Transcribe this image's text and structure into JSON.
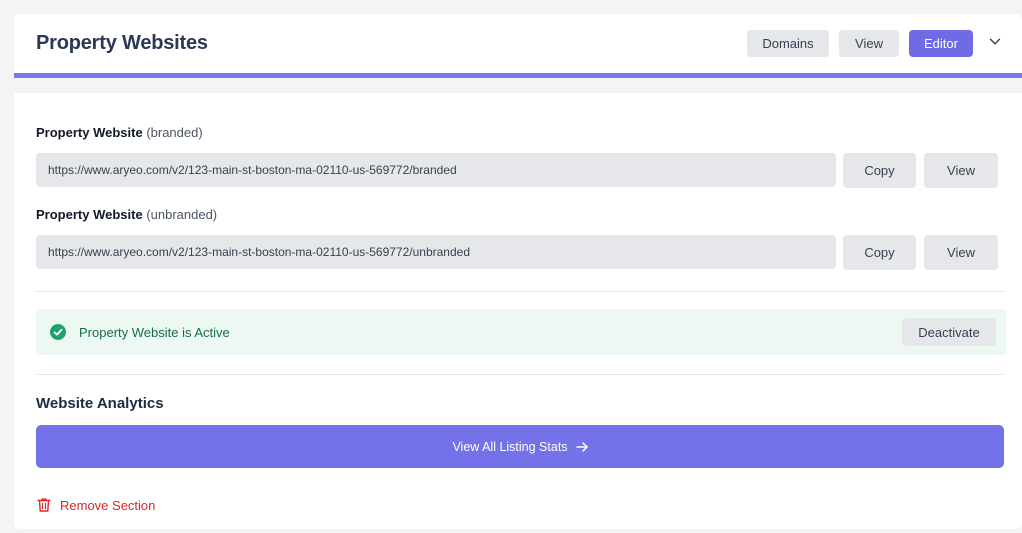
{
  "header": {
    "title": "Property Websites",
    "buttons": {
      "domains": "Domains",
      "view": "View",
      "editor": "Editor"
    },
    "accent_color": "#7b78e8"
  },
  "branded": {
    "label_strong": "Property Website",
    "label_note": "(branded)",
    "url": "https://www.aryeo.com/v2/123-main-st-boston-ma-02110-us-569772/branded",
    "copy_label": "Copy",
    "view_label": "View"
  },
  "unbranded": {
    "label_strong": "Property Website",
    "label_note": "(unbranded)",
    "url": "https://www.aryeo.com/v2/123-main-st-boston-ma-02110-us-569772/unbranded",
    "copy_label": "Copy",
    "view_label": "View"
  },
  "status": {
    "text": "Property Website is Active",
    "icon": "check-circle-icon",
    "color": "#22a06b",
    "action_label": "Deactivate"
  },
  "analytics": {
    "title": "Website Analytics",
    "button_label": "View All Listing Stats",
    "button_icon": "arrow-right-icon"
  },
  "footer": {
    "remove_label": "Remove Section",
    "remove_icon": "trash-icon",
    "remove_color": "#dc2626"
  }
}
